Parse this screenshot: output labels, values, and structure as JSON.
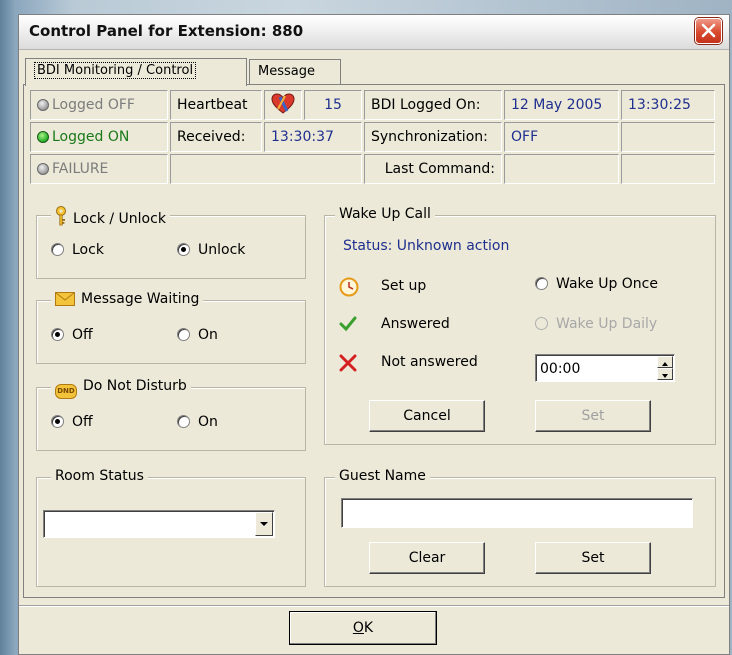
{
  "window": {
    "title": "Control Panel for Extension: 880"
  },
  "tabs": [
    {
      "label": "BDI Monitoring / Control"
    },
    {
      "label": "Message"
    }
  ],
  "status": {
    "logged_off": "Logged OFF",
    "logged_on": "Logged ON",
    "failure": "FAILURE",
    "heartbeat_label": "Heartbeat",
    "heartbeat_value": "15",
    "received_label": "Received:",
    "received_value": "13:30:37",
    "bdi_logged_on_label": "BDI Logged On:",
    "bdi_logged_on_date": "12 May 2005",
    "bdi_logged_on_time": "13:30:25",
    "synchronization_label": "Synchronization:",
    "synchronization_value": "OFF",
    "last_command_label": "Last Command:"
  },
  "lock": {
    "legend": "Lock / Unlock",
    "lock": "Lock",
    "unlock": "Unlock",
    "selected": "unlock"
  },
  "message_waiting": {
    "legend": "Message Waiting",
    "off": "Off",
    "on": "On",
    "selected": "off"
  },
  "dnd": {
    "legend": "Do Not Disturb",
    "off": "Off",
    "on": "On",
    "selected": "off",
    "icon_text": "DND"
  },
  "room_status": {
    "legend": "Room Status",
    "value": ""
  },
  "wakeup": {
    "legend": "Wake Up Call",
    "status": "Status: Unknown action",
    "set_up": "Set up",
    "answered": "Answered",
    "not_answered": "Not answered",
    "once": "Wake Up Once",
    "daily": "Wake Up Daily",
    "time": "00:00",
    "cancel": "Cancel",
    "set": "Set"
  },
  "guest": {
    "legend": "Guest Name",
    "value": "",
    "clear": "Clear",
    "set": "Set"
  },
  "ok": "OK",
  "colors": {
    "blue_text": "#1f2f8f",
    "green_text": "#1a7a1a",
    "window_bg": "#ece9d8"
  }
}
